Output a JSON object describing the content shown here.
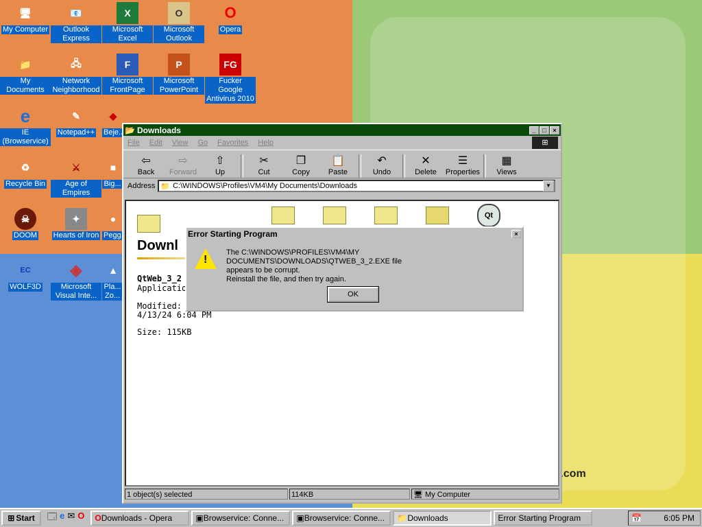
{
  "desktop": {
    "icons": [
      {
        "label": "My Computer",
        "glyph": "🖥"
      },
      {
        "label": "Outlook Express",
        "glyph": "📧"
      },
      {
        "label": "Microsoft Excel",
        "glyph": "X"
      },
      {
        "label": "Microsoft Outlook",
        "glyph": "O"
      },
      {
        "label": "Opera",
        "glyph": "O"
      },
      {
        "label": "My Documents",
        "glyph": "📁"
      },
      {
        "label": "Network Neighborhood",
        "glyph": "🖧"
      },
      {
        "label": "Microsoft FrontPage",
        "glyph": "F"
      },
      {
        "label": "Microsoft PowerPoint",
        "glyph": "P"
      },
      {
        "label": "Fucker Google Antivirus 2010",
        "glyph": "FG"
      },
      {
        "label": "IE (Browservice)",
        "glyph": "e"
      },
      {
        "label": "Notepad++",
        "glyph": "✎"
      },
      {
        "label": "Beje...",
        "glyph": "◆"
      },
      {
        "label": "Recycle Bin",
        "glyph": "♻"
      },
      {
        "label": "Age of Empires",
        "glyph": "⚔"
      },
      {
        "label": "Big...",
        "glyph": "■"
      },
      {
        "label": "DOOM",
        "glyph": "☠"
      },
      {
        "label": "Hearts of Iron",
        "glyph": "✦"
      },
      {
        "label": "Pegg...",
        "glyph": "●"
      },
      {
        "label": "WOLF3D",
        "glyph": "EC"
      },
      {
        "label": "Microsoft Visual Inte...",
        "glyph": "◈"
      },
      {
        "label": "Pla... Zo...",
        "glyph": "▲"
      }
    ],
    "brand_text": "t.com"
  },
  "explorer": {
    "title": "Downloads",
    "menu": [
      "File",
      "Edit",
      "View",
      "Go",
      "Favorites",
      "Help"
    ],
    "toolbar": [
      {
        "label": "Back",
        "icon": "⇦"
      },
      {
        "label": "Forward",
        "icon": "⇨"
      },
      {
        "label": "Up",
        "icon": "⇧"
      },
      {
        "label": "Cut",
        "icon": "✂"
      },
      {
        "label": "Copy",
        "icon": "❐"
      },
      {
        "label": "Paste",
        "icon": "📋"
      },
      {
        "label": "Undo",
        "icon": "↶"
      },
      {
        "label": "Delete",
        "icon": "✕"
      },
      {
        "label": "Properties",
        "icon": "☰"
      },
      {
        "label": "Views",
        "icon": "▦"
      }
    ],
    "address_label": "Address",
    "address_value": "C:\\WINDOWS\\Profiles\\VM4\\My Documents\\Downloads",
    "info": {
      "heading": "Downl",
      "name": "QtWeb_3_2",
      "type": "Application",
      "modified_label": "Modified:",
      "modified_value": "4/13/24 6:04 PM",
      "size": "Size: 115KB"
    },
    "status": {
      "selected": "1 object(s) selected",
      "size": "114KB",
      "zone": "My Computer"
    }
  },
  "dialog": {
    "title": "Error Starting Program",
    "line1": "The C:\\WINDOWS\\PROFILES\\VM4\\MY DOCUMENTS\\DOWNLOADS\\QTWEB_3_2.EXE file",
    "line2": "appears to be corrupt.",
    "line3": "Reinstall the file, and then try again.",
    "ok": "OK"
  },
  "taskbar": {
    "start": "Start",
    "tasks": [
      "Downloads - Opera",
      "Browservice: Conne...",
      "Browservice: Conne...",
      "Downloads",
      "Error Starting Program"
    ],
    "clock": "6:05 PM"
  },
  "colors": {
    "title_active": "#0a4a0a",
    "desktop_orange": "#e88b4a",
    "desktop_green": "#9cc978",
    "desktop_blue": "#5d8fd6",
    "desktop_yellow": "#e9dd57"
  }
}
